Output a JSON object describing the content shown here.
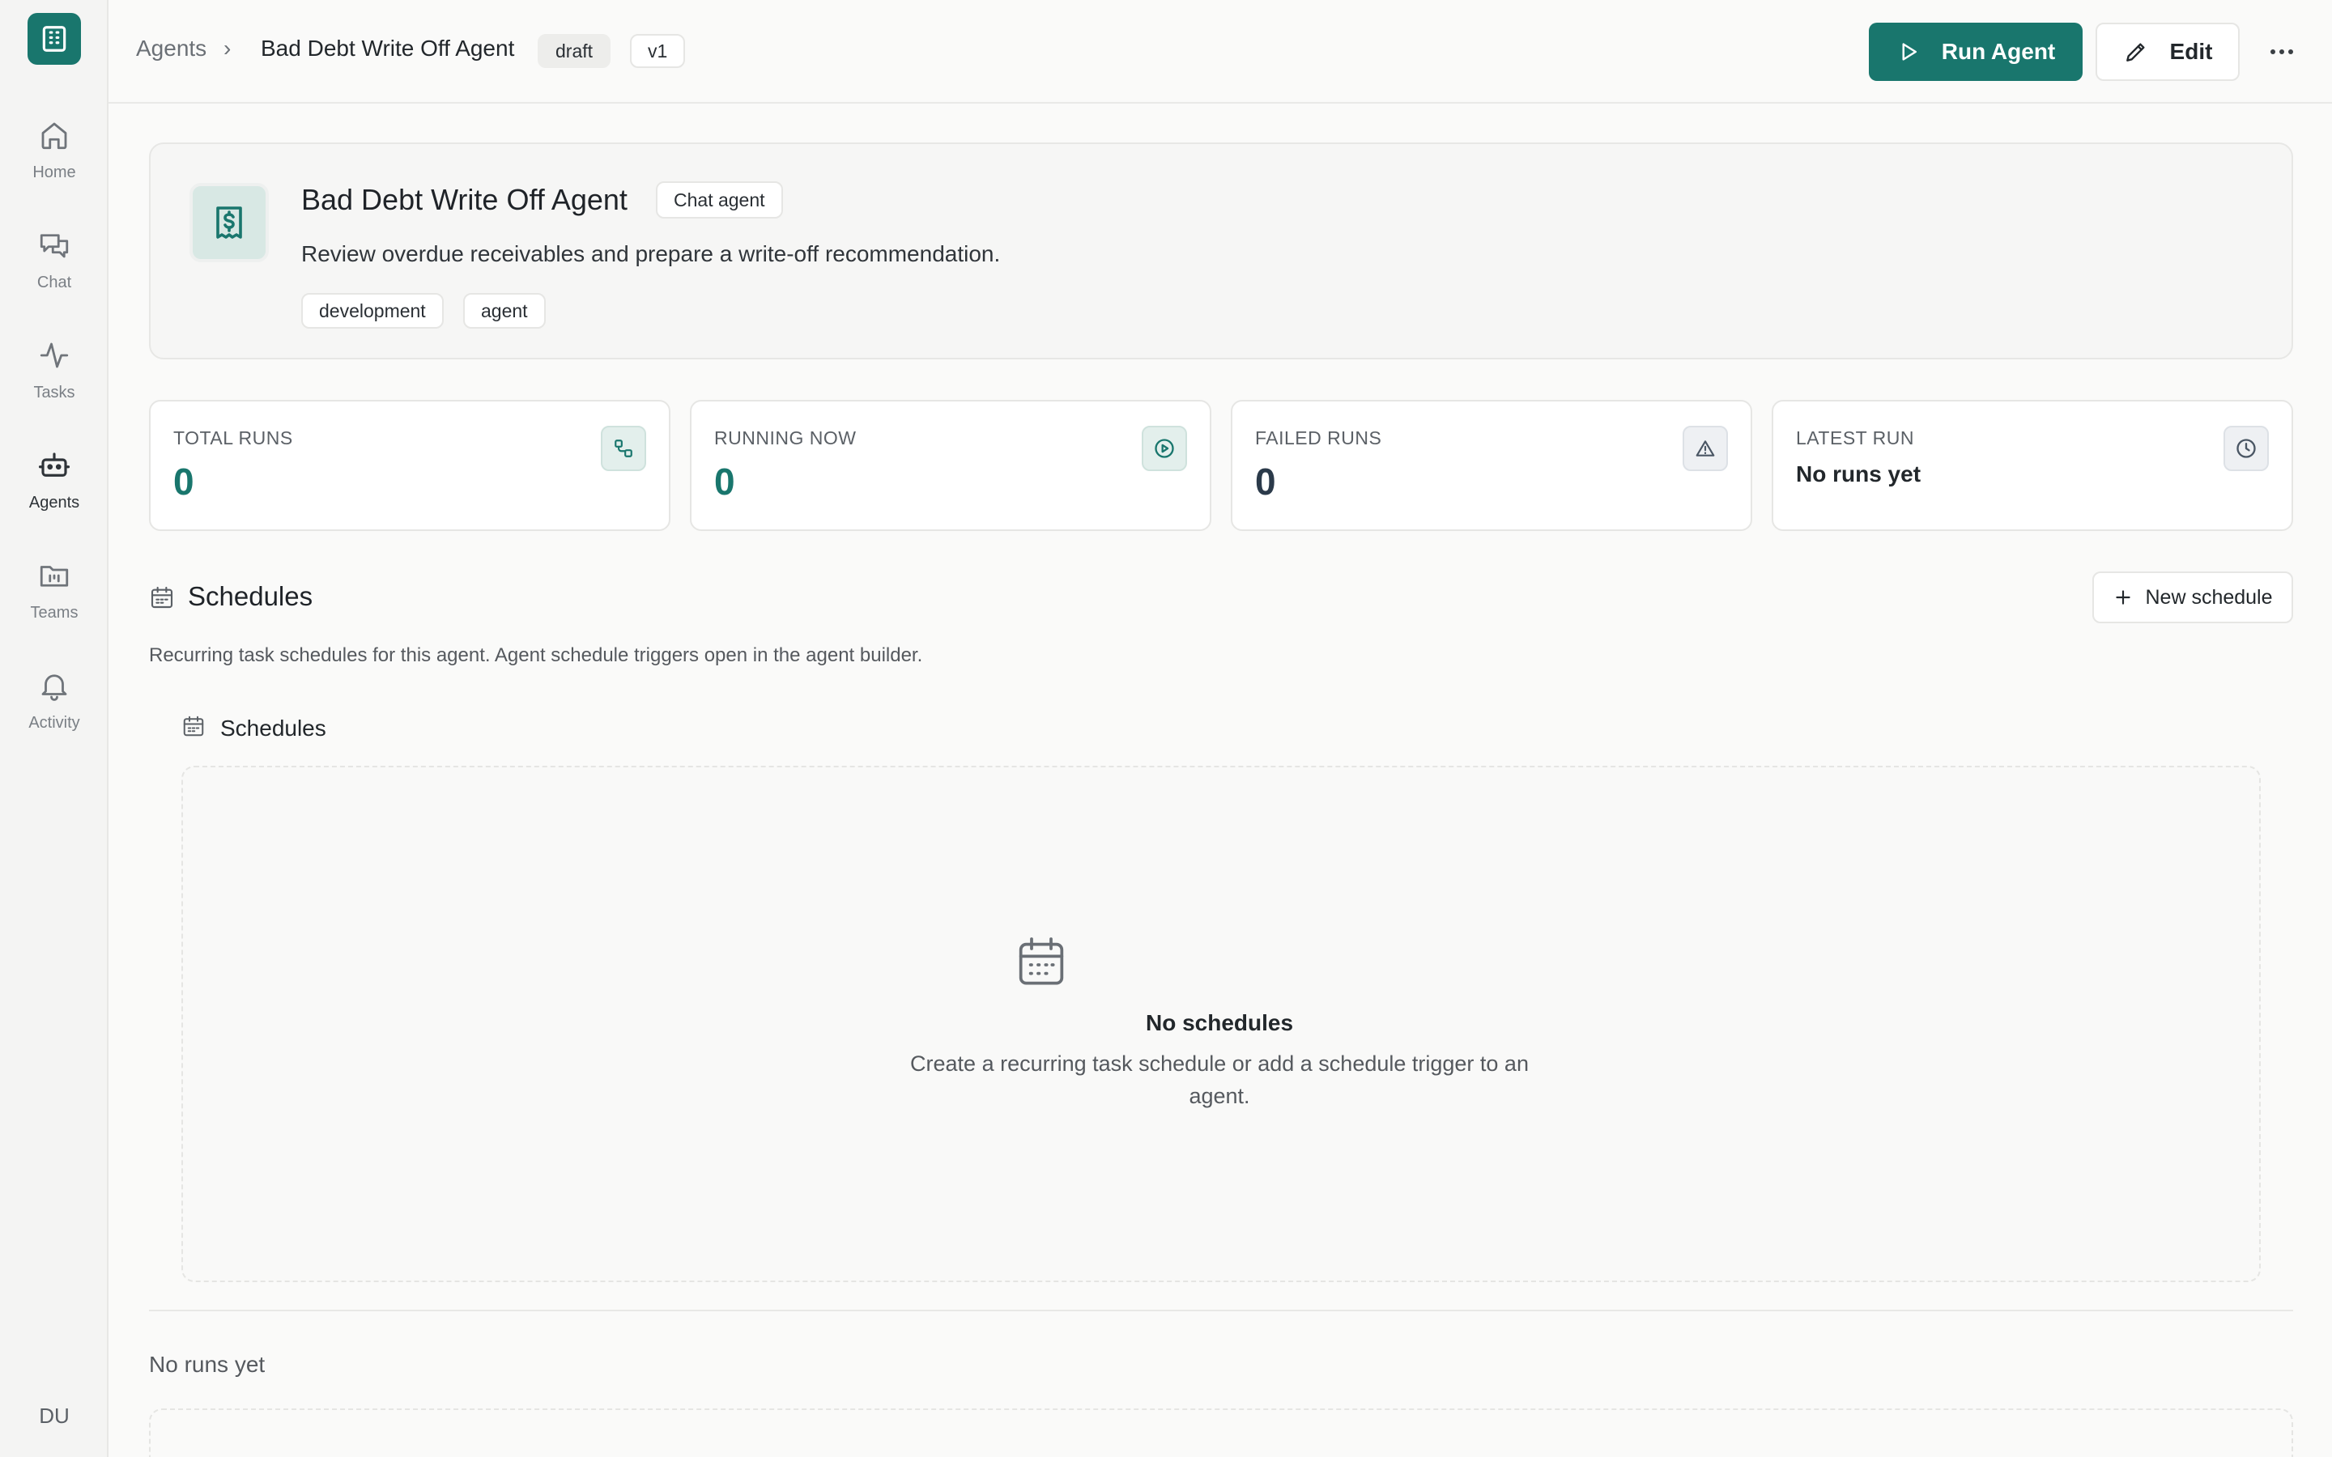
{
  "sidebar": {
    "items": [
      {
        "label": "Home",
        "icon": "home-icon"
      },
      {
        "label": "Chat",
        "icon": "chat-icon"
      },
      {
        "label": "Tasks",
        "icon": "activity-pulse-icon"
      },
      {
        "label": "Agents",
        "icon": "robot-icon"
      },
      {
        "label": "Teams",
        "icon": "folder-icon"
      },
      {
        "label": "Activity",
        "icon": "bell-icon"
      }
    ],
    "active": "Agents",
    "user_initials": "DU"
  },
  "topbar": {
    "breadcrumb_root": "Agents",
    "breadcrumb_sep": "›",
    "breadcrumb_current": "Bad Debt Write Off Agent",
    "status_badge": "draft",
    "version_badge": "v1",
    "run_label": "Run Agent",
    "edit_label": "Edit",
    "more_icon": "more-horizontal-icon"
  },
  "agent": {
    "title": "Bad Debt Write Off Agent",
    "type": "Chat agent",
    "description": "Review overdue receivables and prepare a write-off recommendation.",
    "tags": [
      "development",
      "agent"
    ],
    "icon": "receipt-dollar-icon"
  },
  "stats": [
    {
      "label": "TOTAL RUNS",
      "value": "0",
      "icon": "workflow-icon"
    },
    {
      "label": "RUNNING NOW",
      "value": "0",
      "icon": "play-circle-icon"
    },
    {
      "label": "FAILED RUNS",
      "value": "0",
      "icon": "warning-triangle-icon"
    },
    {
      "label": "LATEST RUN",
      "value": "No runs yet",
      "icon": "clock-icon"
    }
  ],
  "schedules": {
    "title": "Schedules",
    "subtitle": "Recurring task schedules for this agent. Agent schedule triggers open in the agent builder.",
    "new_label": "New schedule",
    "panel_title": "Schedules",
    "empty_title": "No schedules",
    "empty_desc": "Create a recurring task schedule or add a schedule trigger to an agent."
  },
  "runs": {
    "empty": "No runs yet"
  },
  "colors": {
    "accent": "#19766d",
    "background": "#fafaf9",
    "sidebar": "#f4f4f3"
  }
}
